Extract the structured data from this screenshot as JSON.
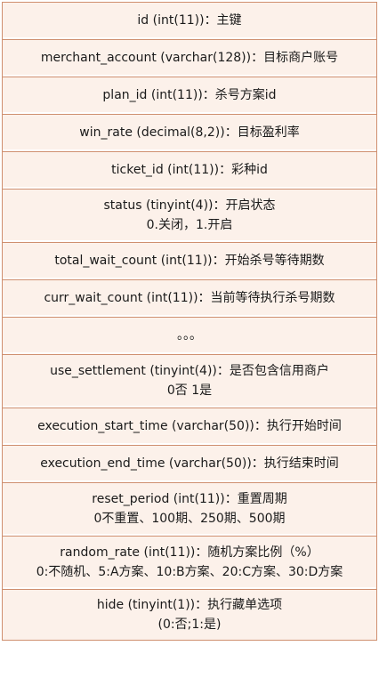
{
  "fields": [
    {
      "lines": [
        "id (int(11))：主键"
      ]
    },
    {
      "lines": [
        "merchant_account (varchar(128))：目标商户账号"
      ]
    },
    {
      "lines": [
        "plan_id (int(11))：杀号方案id"
      ]
    },
    {
      "lines": [
        "win_rate (decimal(8,2))：目标盈利率"
      ]
    },
    {
      "lines": [
        "ticket_id (int(11))：彩种id"
      ]
    },
    {
      "lines": [
        "status (tinyint(4))：开启状态",
        "0.关闭，1.开启"
      ]
    },
    {
      "lines": [
        "total_wait_count (int(11))：开始杀号等待期数"
      ]
    },
    {
      "lines": [
        "curr_wait_count (int(11))：当前等待执行杀号期数"
      ]
    },
    {
      "lines": [
        "。。。"
      ]
    },
    {
      "lines": [
        "use_settlement (tinyint(4))：是否包含信用商户",
        "0否 1是"
      ]
    },
    {
      "lines": [
        "execution_start_time (varchar(50))：执行开始时间"
      ]
    },
    {
      "lines": [
        "execution_end_time (varchar(50))：执行结束时间"
      ]
    },
    {
      "lines": [
        "reset_period (int(11))：重置周期",
        "0不重置、100期、250期、500期"
      ]
    },
    {
      "lines": [
        "random_rate (int(11))：随机方案比例（%）",
        "0:不随机、5:A方案、10:B方案、20:C方案、30:D方案"
      ]
    },
    {
      "lines": [
        "hide (tinyint(1))：执行藏单选项",
        "(0:否;1:是)"
      ]
    }
  ]
}
